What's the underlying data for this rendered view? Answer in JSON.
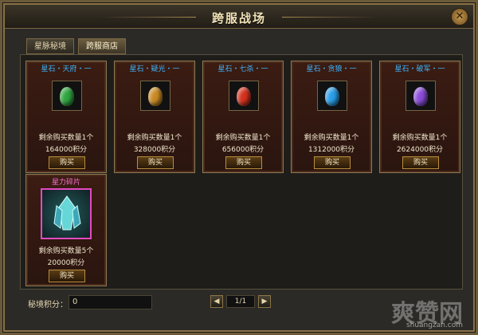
{
  "window": {
    "title": "跨服战场",
    "close_label": "✕"
  },
  "tabs": [
    {
      "label": "星脉秘境",
      "active": false
    },
    {
      "label": "跨服商店",
      "active": true
    }
  ],
  "shop": {
    "items": [
      {
        "name": "星石・天府・一",
        "remaining": "剩余购买数量1个",
        "points": "164000积分",
        "buy_label": "购买",
        "icon": "green-gem-icon",
        "color": "#2fa53f"
      },
      {
        "name": "星石・疑光・一",
        "remaining": "剩余购买数量1个",
        "points": "328000积分",
        "buy_label": "购买",
        "icon": "orange-gem-icon",
        "color": "#c98a24"
      },
      {
        "name": "星石・七杀・一",
        "remaining": "剩余购买数量1个",
        "points": "656000积分",
        "buy_label": "购买",
        "icon": "red-gem-icon",
        "color": "#d4321e"
      },
      {
        "name": "星石・贪狼・一",
        "remaining": "剩余购买数量1个",
        "points": "1312000积分",
        "buy_label": "购买",
        "icon": "blue-gem-icon",
        "color": "#2a9ee8"
      },
      {
        "name": "星石・破军・一",
        "remaining": "剩余购买数量1个",
        "points": "2624000积分",
        "buy_label": "购买",
        "icon": "purple-gem-icon",
        "color": "#8a4dd8"
      },
      {
        "name": "星力碎片",
        "remaining": "剩余购买数量5个",
        "points": "20000积分",
        "buy_label": "购买",
        "icon": "crystal-shard-icon",
        "color": "#67d6d7"
      }
    ]
  },
  "footer": {
    "points_label": "秘境积分：",
    "points_value": "0"
  },
  "pager": {
    "prev_icon": "◀",
    "page_text": "1/1",
    "next_icon": "▶"
  },
  "watermark": {
    "brand": "爽赞网",
    "url": "shuangzan.com"
  }
}
